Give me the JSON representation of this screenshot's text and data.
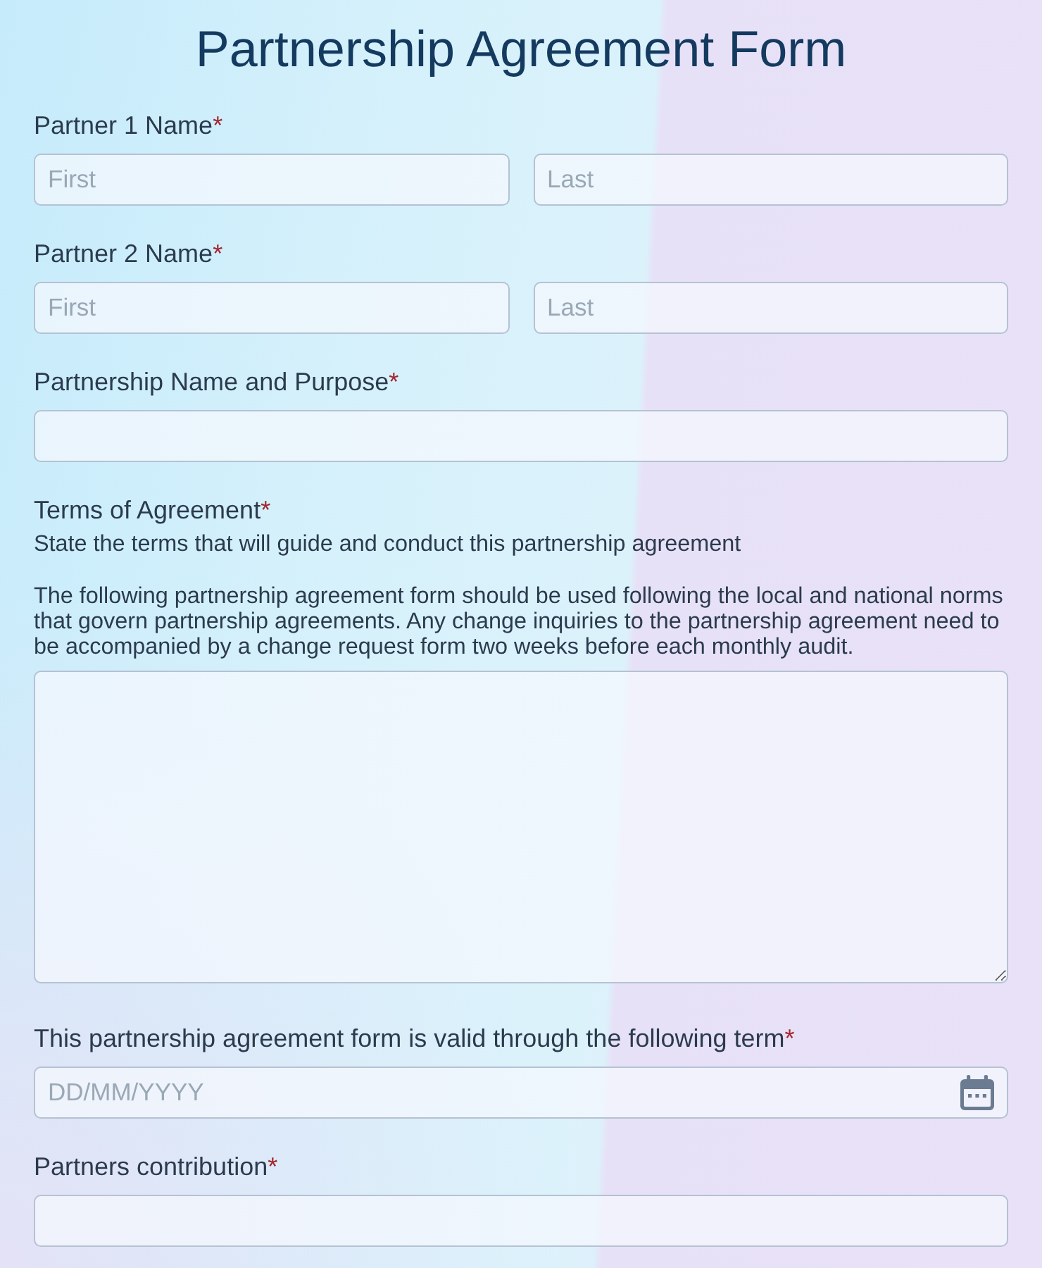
{
  "title": "Partnership Agreement Form",
  "fields": [
    {
      "kind": "split",
      "label": "Partner 1 Name",
      "required_mark": "*",
      "inputs": [
        {
          "placeholder": "First"
        },
        {
          "placeholder": "Last"
        }
      ]
    },
    {
      "kind": "split",
      "label": "Partner 2 Name",
      "required_mark": "*",
      "inputs": [
        {
          "placeholder": "First"
        },
        {
          "placeholder": "Last"
        }
      ]
    },
    {
      "kind": "text",
      "label": "Partnership Name and Purpose",
      "required_mark": "*"
    },
    {
      "kind": "textarea",
      "label": "Terms of Agreement",
      "required_mark": "*",
      "description": "State the terms that will guide and conduct this partnership agreement",
      "note": "The following partnership agreement form should be used following the local and national norms that govern partnership agreements. Any change inquiries to the partnership agreement need to be accompanied by a change request form two weeks before each monthly audit."
    },
    {
      "kind": "date",
      "label": "This partnership agreement form is valid through the following term",
      "required_mark": "*",
      "placeholder": "DD/MM/YYYY"
    },
    {
      "kind": "text",
      "label": "Partners contribution",
      "required_mark": "*"
    }
  ]
}
